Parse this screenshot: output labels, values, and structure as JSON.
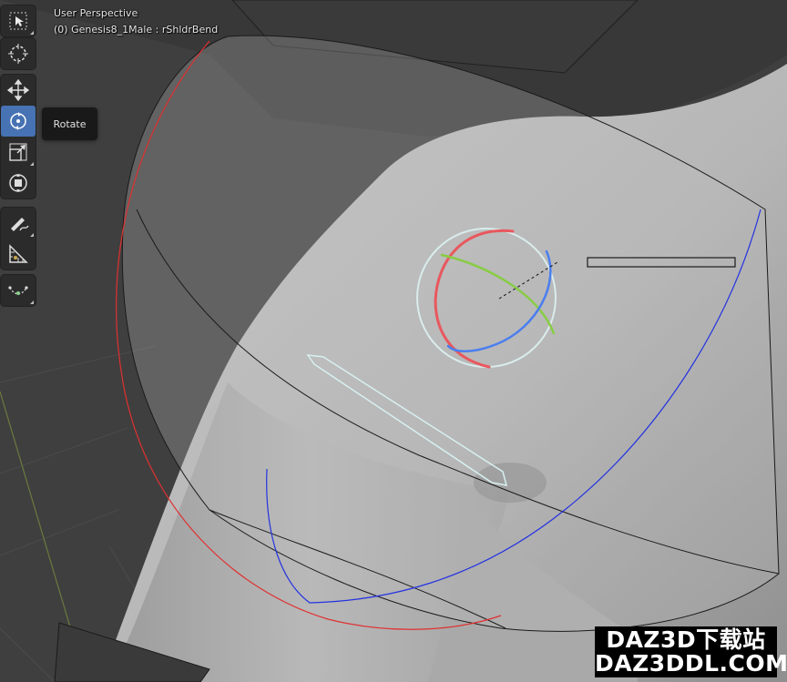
{
  "viewport": {
    "view_name": "User Perspective",
    "object_info": "(0) Genesis8_1Male : rShldrBend"
  },
  "toolbar": {
    "tools": [
      {
        "name": "select-box",
        "icon": "select-box-icon",
        "active": false
      },
      {
        "name": "cursor",
        "icon": "cursor-icon",
        "active": false
      },
      {
        "name": "move",
        "icon": "move-icon",
        "active": false
      },
      {
        "name": "rotate",
        "icon": "rotate-icon",
        "active": true
      },
      {
        "name": "scale",
        "icon": "scale-icon",
        "active": false
      },
      {
        "name": "transform",
        "icon": "transform-icon",
        "active": false
      },
      {
        "name": "annotate",
        "icon": "annotate-icon",
        "active": false
      },
      {
        "name": "measure",
        "icon": "measure-icon",
        "active": false
      },
      {
        "name": "pose-relax",
        "icon": "pose-icon",
        "active": false
      }
    ],
    "tooltip": "Rotate"
  },
  "gizmo": {
    "x_axis_color": "#e8585e",
    "y_axis_color": "#88cc44",
    "z_axis_color": "#4a7ef0",
    "outer_ring_color": "#d9ecec"
  },
  "theme": {
    "active_tool_color": "#4772b3"
  },
  "watermark": {
    "line1": "DAZ3D下载站",
    "line2": "DAZ3DDL.COM"
  }
}
